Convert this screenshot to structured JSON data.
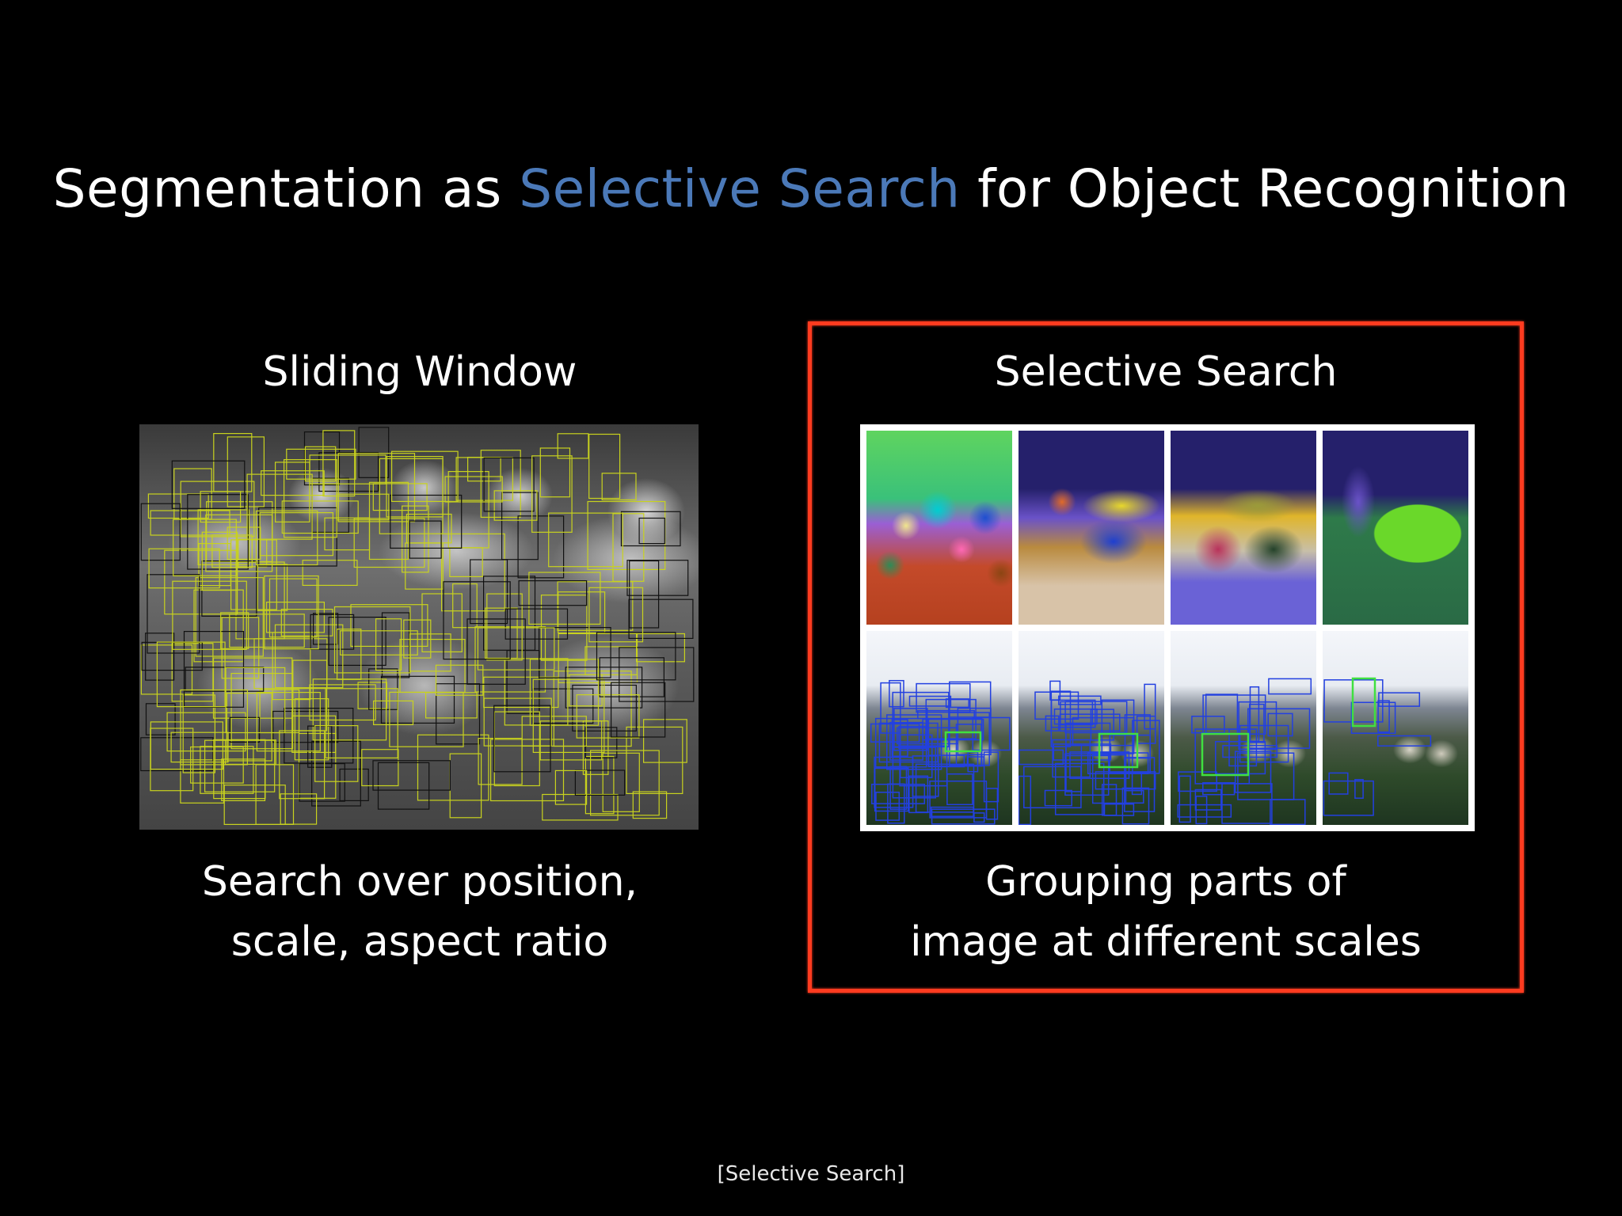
{
  "slide": {
    "title_prefix": "Segmentation as ",
    "title_highlight": "Selective Search",
    "title_suffix": " for Object Recognition",
    "highlight_color": "#4b79b8",
    "left": {
      "heading": "Sliding Window",
      "caption_line1": "Search over position,",
      "caption_line2": "scale, aspect ratio",
      "image_icon": "sliding-window-photo"
    },
    "right": {
      "heading": "Selective Search",
      "caption_line1": "Grouping parts of",
      "caption_line2": "image at different scales",
      "frame_color": "#ff3b1f",
      "image_icon": "selective-search-grid"
    },
    "footnote": "[Selective Search]"
  }
}
